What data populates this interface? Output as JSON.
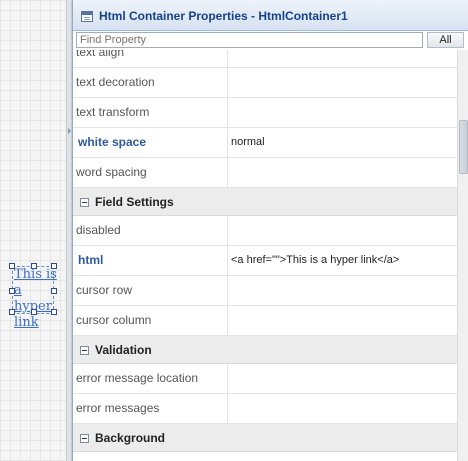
{
  "canvas": {
    "html_container": {
      "link_text": "This is a hyper link"
    }
  },
  "panel": {
    "title": "Html Container Properties - HtmlContainer1",
    "search": {
      "placeholder": "Find Property",
      "value": ""
    },
    "all_button": "All",
    "rows": [
      {
        "name": "text align",
        "value": ""
      },
      {
        "name": "text decoration",
        "value": ""
      },
      {
        "name": "text transform",
        "value": ""
      },
      {
        "name": "white space",
        "value": "normal",
        "bold": true
      },
      {
        "name": "word spacing",
        "value": ""
      }
    ],
    "groups": [
      {
        "label": "Field Settings",
        "rows": [
          {
            "name": "disabled",
            "value": ""
          },
          {
            "name": "html",
            "value": "<a href=\"\">This is a hyper link</a>",
            "bold": true
          },
          {
            "name": "cursor row",
            "value": ""
          },
          {
            "name": "cursor column",
            "value": ""
          }
        ]
      },
      {
        "label": "Validation",
        "rows": [
          {
            "name": "error message location",
            "value": ""
          },
          {
            "name": "error messages",
            "value": ""
          }
        ]
      },
      {
        "label": "Background",
        "rows": []
      }
    ]
  },
  "colors": {
    "title_text": "#15428b",
    "bold_property": "#2f5a9e",
    "link": "#3b6ec5"
  },
  "icons": [
    "window-icon",
    "collapse-icon",
    "splitter-arrow-icon"
  ]
}
